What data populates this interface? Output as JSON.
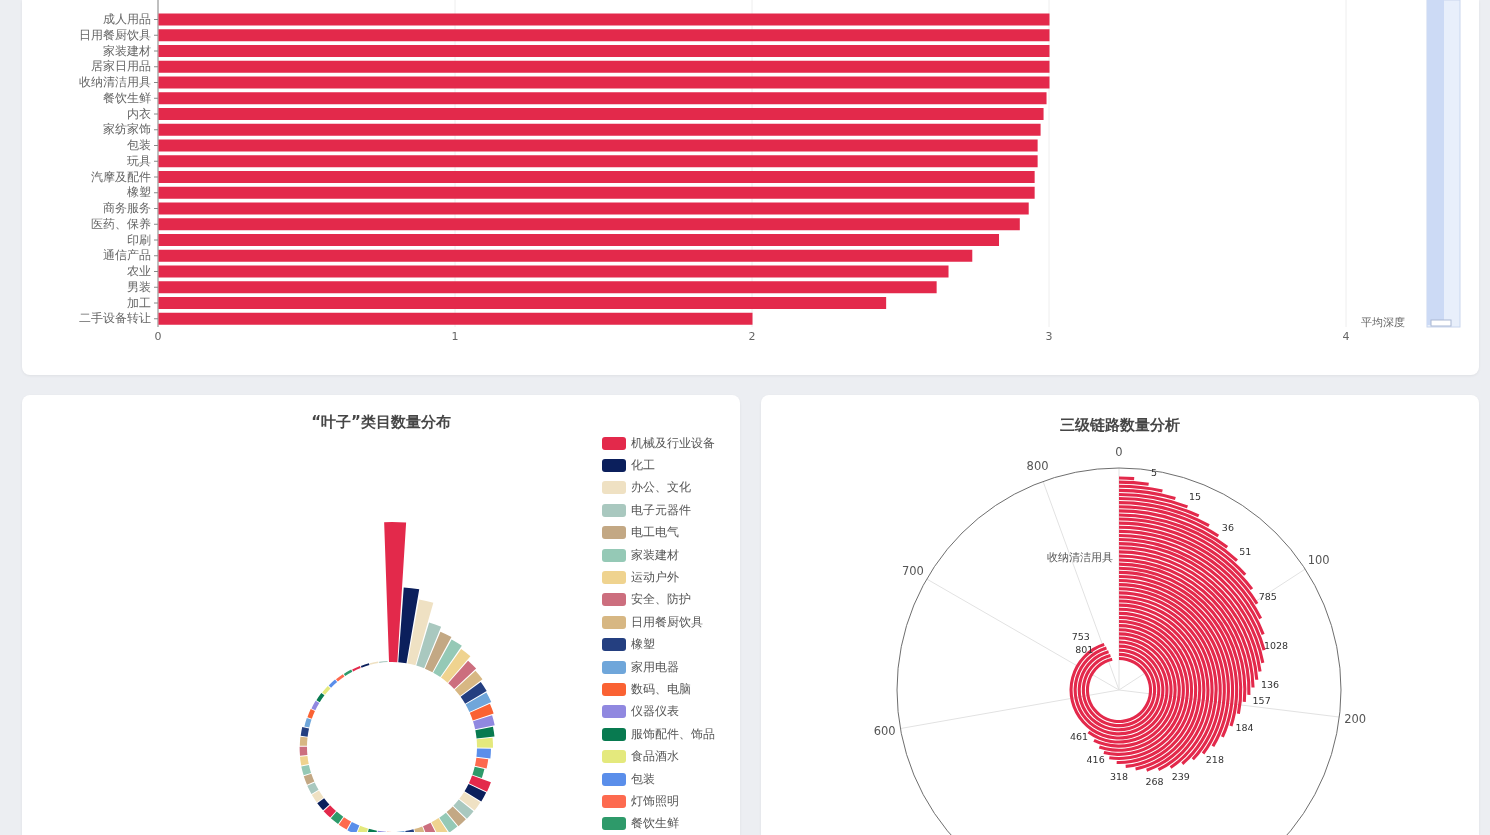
{
  "top_chart": {
    "chart_data": {
      "type": "bar",
      "orientation": "horizontal",
      "xlabel": "平均深度",
      "categories": [
        "成人用品",
        "日用餐厨饮具",
        "家装建材",
        "居家日用品",
        "收纳清洁用具",
        "餐饮生鲜",
        "内衣",
        "家纺家饰",
        "包装",
        "玩具",
        "汽摩及配件",
        "橡塑",
        "商务服务",
        "医药、保养",
        "印刷",
        "通信产品",
        "农业",
        "男装",
        "加工",
        "二手设备转让"
      ],
      "values": [
        3.0,
        3.0,
        3.0,
        3.0,
        3.0,
        2.99,
        2.98,
        2.97,
        2.96,
        2.96,
        2.95,
        2.95,
        2.93,
        2.9,
        2.83,
        2.74,
        2.66,
        2.62,
        2.45,
        2.0
      ],
      "xlim": [
        0,
        4
      ],
      "xticks": [
        0,
        1,
        2,
        3,
        4
      ],
      "grid": true
    }
  },
  "leaf_chart": {
    "title": "“叶子”类目数量分布",
    "legend": [
      {
        "label": "机械及行业设备",
        "color": "#e3294b"
      },
      {
        "label": "化工",
        "color": "#0b1f5c"
      },
      {
        "label": "办公、文化",
        "color": "#efe1c3"
      },
      {
        "label": "电子元器件",
        "color": "#a9c8bf"
      },
      {
        "label": "电工电气",
        "color": "#c3a884"
      },
      {
        "label": "家装建材",
        "color": "#95c9b6"
      },
      {
        "label": "运动户外",
        "color": "#efd38f"
      },
      {
        "label": "安全、防护",
        "color": "#cc6e7e"
      },
      {
        "label": "日用餐厨饮具",
        "color": "#d7b783"
      },
      {
        "label": "橡塑",
        "color": "#243f80"
      },
      {
        "label": "家用电器",
        "color": "#6fa6da"
      },
      {
        "label": "数码、电脑",
        "color": "#fa6233"
      },
      {
        "label": "仪器仪表",
        "color": "#9088e0"
      },
      {
        "label": "服饰配件、饰品",
        "color": "#087a50"
      },
      {
        "label": "食品酒水",
        "color": "#e4e97d"
      },
      {
        "label": "包装",
        "color": "#5a8eea"
      },
      {
        "label": "灯饰照明",
        "color": "#fd6a4f"
      },
      {
        "label": "餐饮生鲜",
        "color": "#2e9a6a"
      }
    ]
  },
  "link_chart": {
    "title": "三级链路数量分析",
    "axis_labels": [
      "0",
      "100",
      "200",
      "600",
      "700",
      "800"
    ],
    "radius_label": "收纳清洁用具",
    "bar_labels": [
      "5",
      "15",
      "36",
      "51",
      "785",
      "1028",
      "136",
      "157",
      "184",
      "218",
      "239",
      "268",
      "318",
      "416",
      "461",
      "753",
      "801"
    ]
  }
}
